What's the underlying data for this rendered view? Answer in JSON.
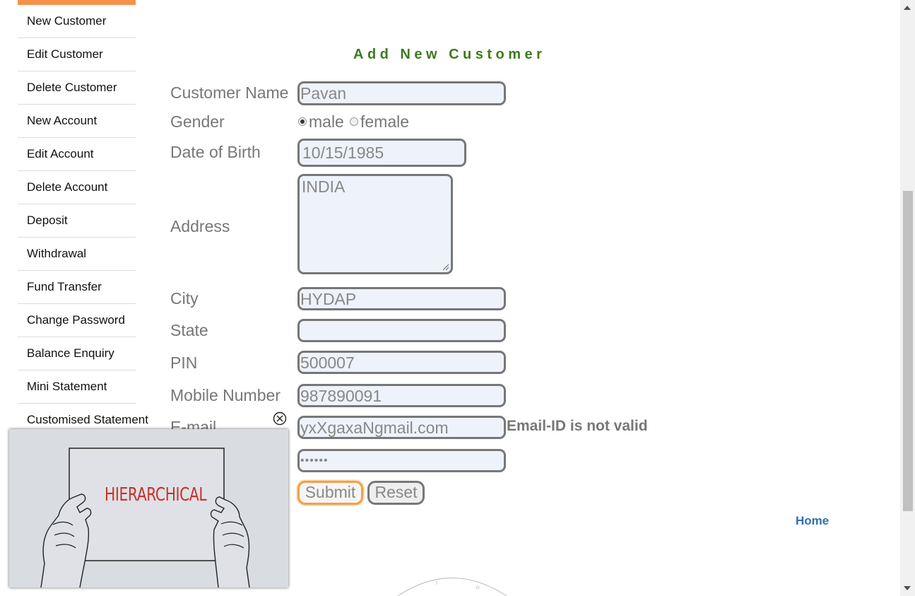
{
  "sidebar": {
    "items": [
      {
        "label": "New Customer"
      },
      {
        "label": "Edit Customer"
      },
      {
        "label": "Delete Customer"
      },
      {
        "label": "New Account"
      },
      {
        "label": "Edit Account"
      },
      {
        "label": "Delete Account"
      },
      {
        "label": "Deposit"
      },
      {
        "label": "Withdrawal"
      },
      {
        "label": "Fund Transfer"
      },
      {
        "label": "Change Password"
      },
      {
        "label": "Balance Enquiry"
      },
      {
        "label": "Mini Statement"
      },
      {
        "label": "Customised Statement"
      }
    ]
  },
  "form": {
    "title": "Add New Customer",
    "fields": {
      "customer_name": {
        "label": "Customer Name",
        "value": "Pavan"
      },
      "gender": {
        "label": "Gender",
        "options": [
          "male",
          "female"
        ],
        "selected": "male"
      },
      "dob": {
        "label": "Date of Birth",
        "value": "10/15/1985"
      },
      "address": {
        "label": "Address",
        "value": "INDIA"
      },
      "city": {
        "label": "City",
        "value": "HYDAP"
      },
      "state": {
        "label": "State",
        "value": ""
      },
      "pin": {
        "label": "PIN",
        "value": "500007"
      },
      "mobile": {
        "label": "Mobile Number",
        "value": "987890091"
      },
      "email": {
        "label": "E-mail",
        "value": "yxXgaxaNgmail.com",
        "error": "Email-ID is not valid"
      },
      "password": {
        "value": "••••••"
      }
    },
    "buttons": {
      "submit": "Submit",
      "reset": "Reset"
    }
  },
  "footer": {
    "home_link": "Home"
  },
  "video_overlay": {
    "sign_text": "HIERARCHICAL",
    "close_icon": "close-circle-icon"
  },
  "colors": {
    "accent_orange": "#f4924a",
    "title_green": "#3e7a1e",
    "link_blue": "#2f6fb0",
    "sign_red": "#c8312a"
  }
}
